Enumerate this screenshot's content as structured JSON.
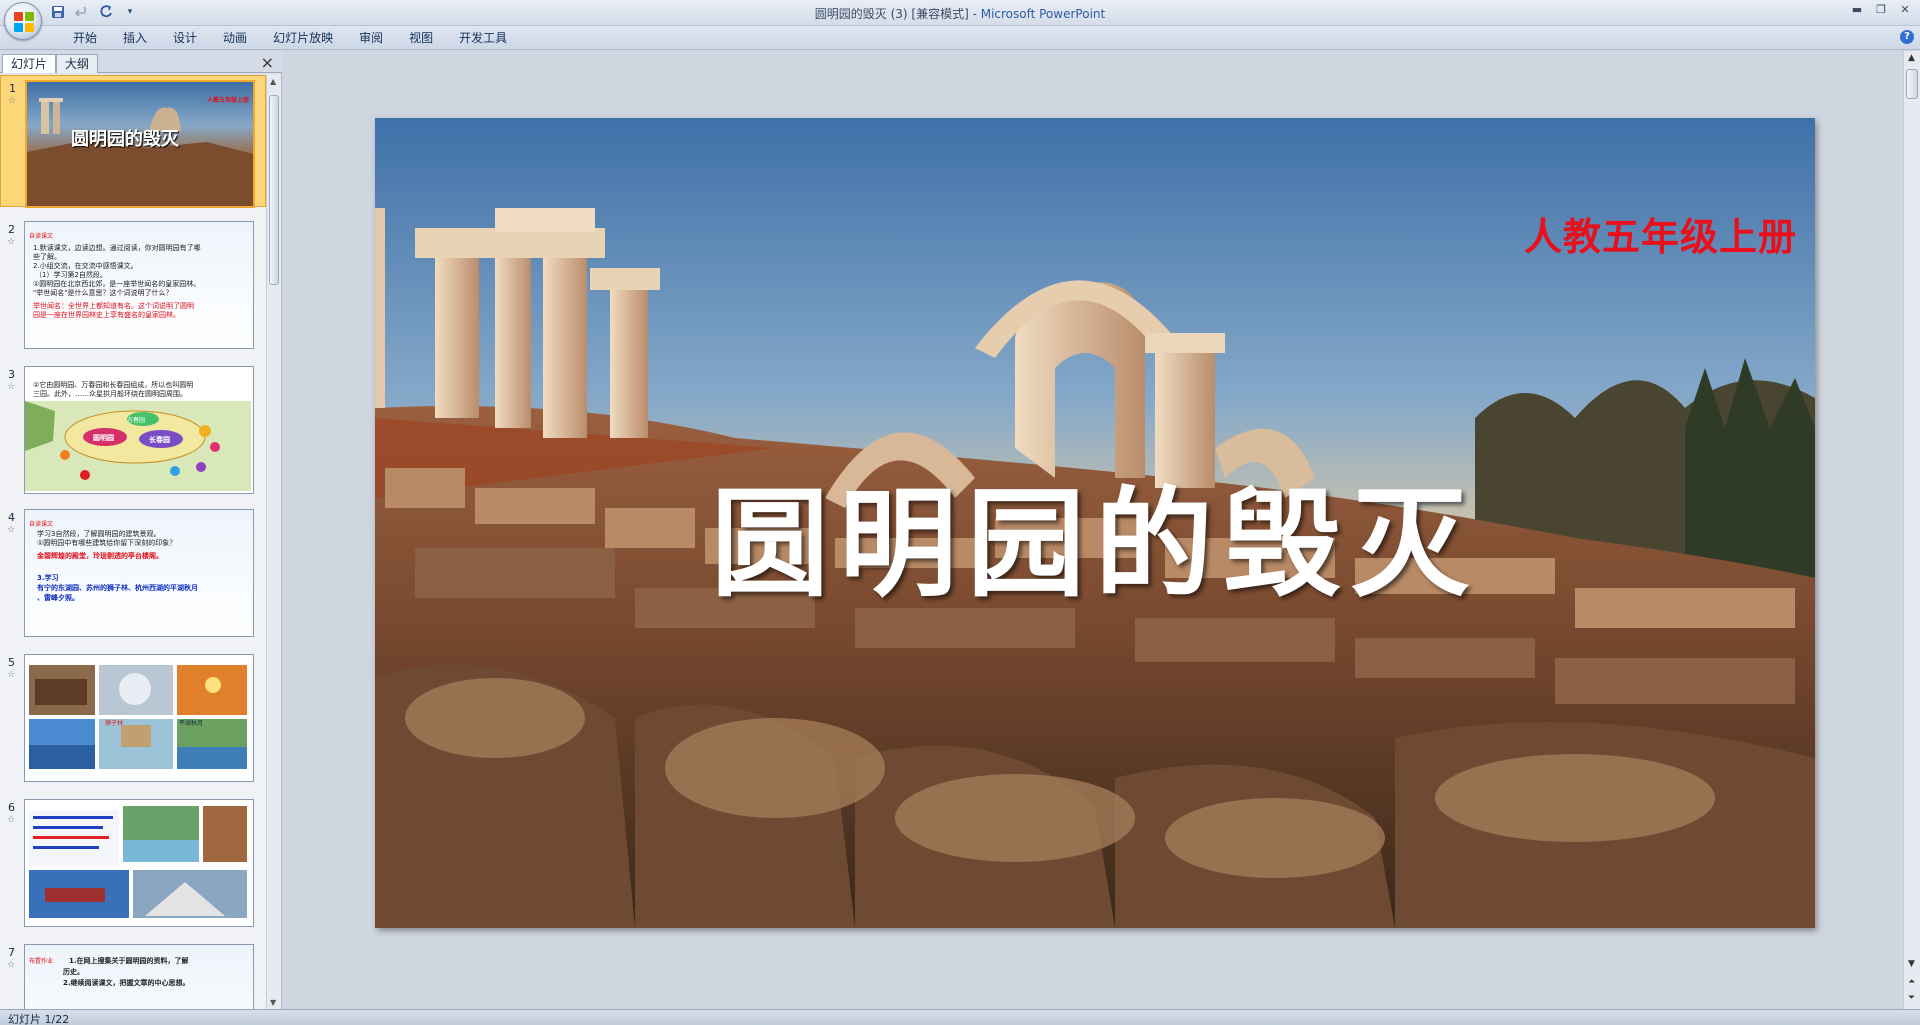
{
  "window": {
    "title": "圆明园的毁灭 (3) [兼容模式] - ",
    "app_name": "Microsoft PowerPoint"
  },
  "quick_access": {
    "save_icon": "save-icon",
    "undo_icon": "undo-icon",
    "redo_icon": "redo-icon",
    "customize_icon": "dropdown-icon"
  },
  "ribbon": {
    "tabs": [
      "开始",
      "插入",
      "设计",
      "动画",
      "幻灯片放映",
      "审阅",
      "视图",
      "开发工具"
    ]
  },
  "panel": {
    "tab_slides": "幻灯片",
    "tab_outline": "大纲",
    "close_symbol": "×"
  },
  "thumbnails": [
    {
      "num": "1",
      "title": "圆明园的毁灭",
      "subtitle": "人教五年级上册"
    },
    {
      "num": "2",
      "tag": "自读课文",
      "lines": [
        "1.默读课文，边读边想。通过阅读，你对圆明园有了哪",
        "些了解。",
        "2.小组交流，在交流中感悟课文。",
        "（1）学习第2自然段。",
        "①圆明园在北京西北郊，是一座举世闻名的皇家园林。",
        "\"举世闻名\"是什么意思？这个词说明了什么？"
      ],
      "red_lines": [
        "举世闻名：全世界上都知道有名。这个词说明了圆明",
        "园是一座在世界园林史上享有盛名的皇家园林。"
      ]
    },
    {
      "num": "3",
      "lines": [
        "②它由圆明园、万春园和长春园组成，所以也叫圆明",
        "三园。此外，……众星拱月般环绕在圆明园周围。"
      ],
      "labels": [
        "万春园",
        "圆明园",
        "长春园"
      ]
    },
    {
      "num": "4",
      "tag": "自读课文",
      "lines": [
        "学习3自然段，了解圆明园的建筑景观。",
        "①圆明园中有哪些建筑给你留下深刻的印象？"
      ],
      "red_lines": [
        "金碧辉煌的殿堂，玲珑剔透的亭台楼阁。"
      ],
      "blue_lines": [
        "3.学习",
        "有宁的东湖园、苏州的狮子林、杭州西湖的平湖秋月",
        "、雷峰夕照。"
      ]
    },
    {
      "num": "5",
      "captions": [
        "平湖秋月",
        "狮子林"
      ]
    },
    {
      "num": "6"
    },
    {
      "num": "7",
      "lines": [
        "1.在网上搜集关于圆明园的资料，了解",
        "历史。",
        "2.继续阅读课文，把握文章的中心思想。"
      ],
      "tag": "布置作业"
    }
  ],
  "slide": {
    "title": "圆明园的毁灭",
    "subtitle": "人教五年级上册"
  },
  "status": {
    "slide_counter": "幻灯片 1/22"
  },
  "colors": {
    "subtitle_red": "#e8101c",
    "selection": "#fbd77a"
  }
}
